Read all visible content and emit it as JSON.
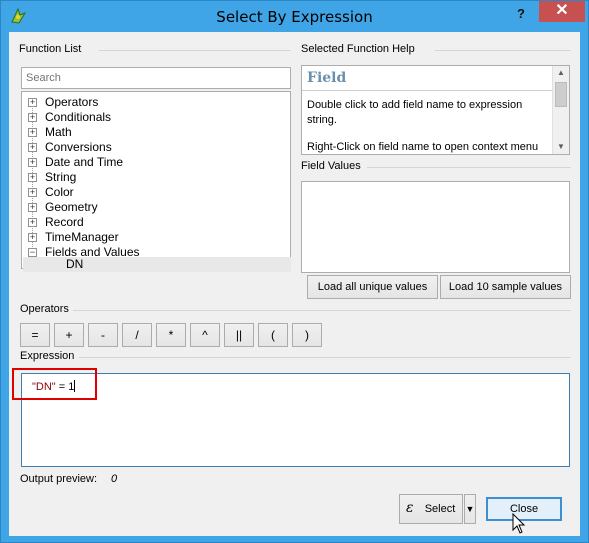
{
  "window": {
    "title": "Select By Expression",
    "help_glyph": "?",
    "close_glyph": "✕"
  },
  "function_list": {
    "group_label": "Function List",
    "search_placeholder": "Search",
    "items": [
      {
        "label": "Operators",
        "expander": "+"
      },
      {
        "label": "Conditionals",
        "expander": "+"
      },
      {
        "label": "Math",
        "expander": "+"
      },
      {
        "label": "Conversions",
        "expander": "+"
      },
      {
        "label": "Date and Time",
        "expander": "+"
      },
      {
        "label": "String",
        "expander": "+"
      },
      {
        "label": "Color",
        "expander": "+"
      },
      {
        "label": "Geometry",
        "expander": "+"
      },
      {
        "label": "Record",
        "expander": "+"
      },
      {
        "label": "TimeManager",
        "expander": "+"
      },
      {
        "label": "Fields and Values",
        "expander": "−"
      }
    ],
    "child_item": "DN"
  },
  "help": {
    "group_label": "Selected Function Help",
    "heading": "Field",
    "line1": "Double click to add field name to expression string.",
    "line2": "Right-Click on field name to open context menu"
  },
  "field_values": {
    "group_label": "Field Values",
    "load_all_label": "Load all unique values",
    "load_sample_label": "Load 10 sample values"
  },
  "operators": {
    "group_label": "Operators",
    "buttons": [
      "=",
      "+",
      "-",
      "/",
      "*",
      "^",
      "||",
      "(",
      ")"
    ]
  },
  "expression": {
    "group_label": "Expression",
    "field_token": "\"DN\"",
    "rest": " = 1"
  },
  "output_preview": {
    "label": "Output preview:",
    "value": "0"
  },
  "footer": {
    "select_label": "Select",
    "close_label": "Close",
    "select_icon": "ε",
    "dropdown_glyph": "▼"
  },
  "colors": {
    "titlebar": "#3fa5e6",
    "close_button": "#c75050",
    "highlight": "#e00000",
    "field_token": "#8b0000"
  }
}
